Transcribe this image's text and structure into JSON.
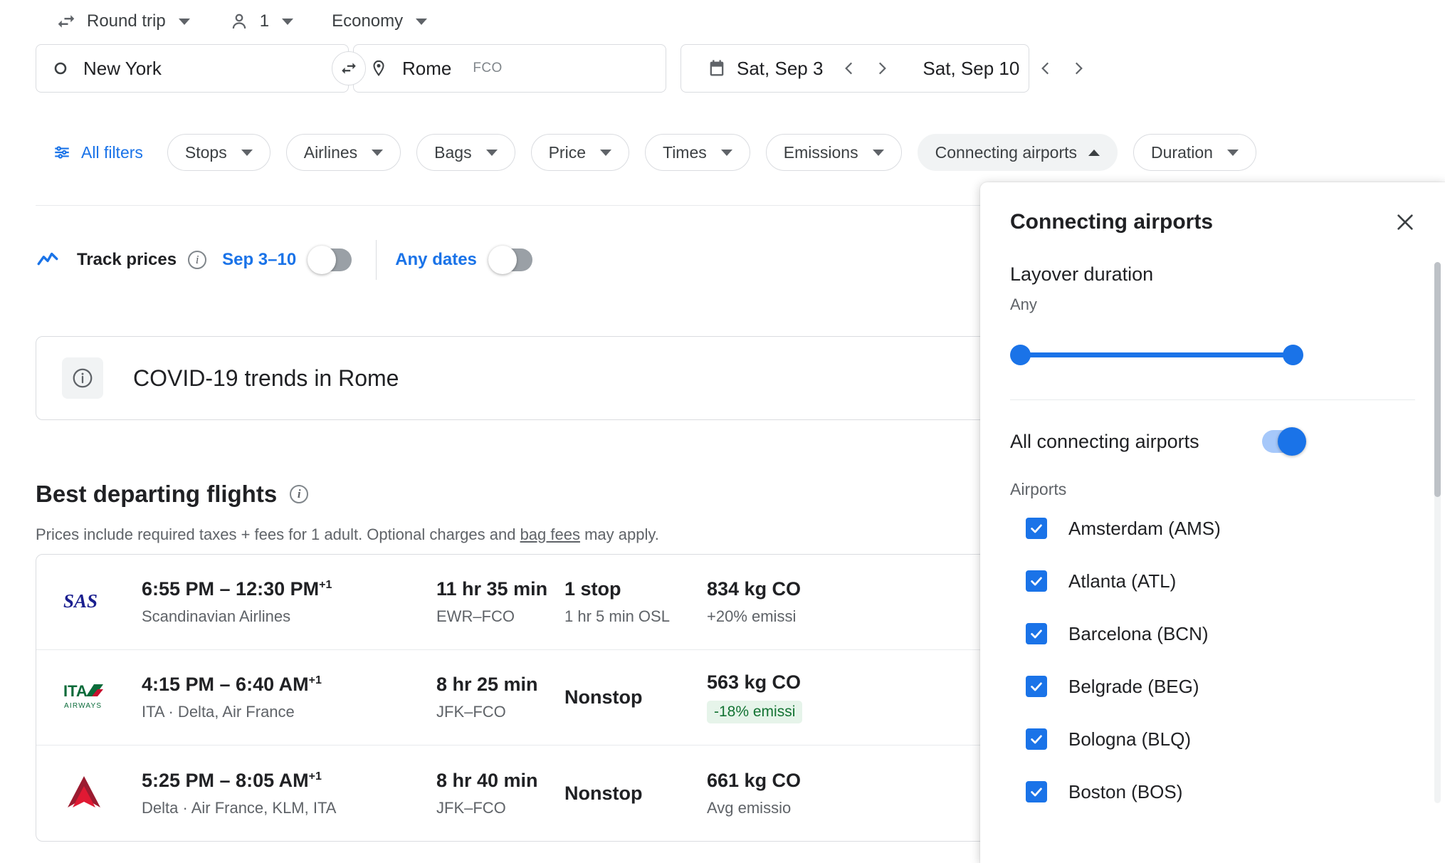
{
  "trip_bar": {
    "trip_type": "Round trip",
    "passengers": "1",
    "cabin_class": "Economy"
  },
  "search": {
    "origin": "New York",
    "destination": "Rome",
    "destination_code": "FCO",
    "depart_date": "Sat, Sep 3",
    "return_date": "Sat, Sep 10"
  },
  "filters": {
    "all_filters": "All filters",
    "chips": [
      {
        "label": "Stops",
        "active": false
      },
      {
        "label": "Airlines",
        "active": false
      },
      {
        "label": "Bags",
        "active": false
      },
      {
        "label": "Price",
        "active": false
      },
      {
        "label": "Times",
        "active": false
      },
      {
        "label": "Emissions",
        "active": false
      },
      {
        "label": "Connecting airports",
        "active": true
      },
      {
        "label": "Duration",
        "active": false
      }
    ]
  },
  "track_prices": {
    "label": "Track prices",
    "date_range": "Sep 3–10",
    "any_dates": "Any dates",
    "date_toggle_on": false,
    "any_dates_toggle_on": false
  },
  "covid": {
    "title": "COVID-19 trends in Rome"
  },
  "best_flights": {
    "title": "Best departing flights",
    "subtitle_before": "Prices include required taxes + fees for 1 adult. Optional charges and ",
    "subtitle_link": "bag fees",
    "subtitle_after": " may apply.",
    "rows": [
      {
        "logo": "sas-logo",
        "times": "6:55 PM – 12:30 PM",
        "next_day": "+1",
        "airline": "Scandinavian Airlines",
        "duration": "11 hr 35 min",
        "route": "EWR–FCO",
        "stops": "1 stop",
        "stop_detail": "1 hr 5 min OSL",
        "emissions": "834 kg CO",
        "emissions_note": "+20% emissi",
        "emissions_badge": null
      },
      {
        "logo": "ita-airways-logo",
        "times": "4:15 PM – 6:40 AM",
        "next_day": "+1",
        "airline": "ITA · Delta, Air France",
        "duration": "8 hr 25 min",
        "route": "JFK–FCO",
        "stops": "Nonstop",
        "stop_detail": "",
        "emissions": "563 kg CO",
        "emissions_note": null,
        "emissions_badge": "-18% emissi"
      },
      {
        "logo": "delta-logo",
        "times": "5:25 PM – 8:05 AM",
        "next_day": "+1",
        "airline": "Delta · Air France, KLM, ITA",
        "duration": "8 hr 40 min",
        "route": "JFK–FCO",
        "stops": "Nonstop",
        "stop_detail": "",
        "emissions": "661 kg CO",
        "emissions_note": "Avg emissio",
        "emissions_badge": null
      }
    ]
  },
  "panel": {
    "title": "Connecting airports",
    "layover_title": "Layover duration",
    "layover_value": "Any",
    "all_connecting_label": "All connecting airports",
    "all_connecting_on": true,
    "airports_label": "Airports",
    "airports": [
      {
        "name": "Amsterdam (AMS)",
        "checked": true
      },
      {
        "name": "Atlanta (ATL)",
        "checked": true
      },
      {
        "name": "Barcelona (BCN)",
        "checked": true
      },
      {
        "name": "Belgrade (BEG)",
        "checked": true
      },
      {
        "name": "Bologna (BLQ)",
        "checked": true
      },
      {
        "name": "Boston (BOS)",
        "checked": true
      }
    ]
  },
  "colors": {
    "accent_blue": "#1a73e8",
    "green": "#137333",
    "green_bg": "#e6f4ea",
    "text": "#202124",
    "muted": "#5f6368"
  }
}
